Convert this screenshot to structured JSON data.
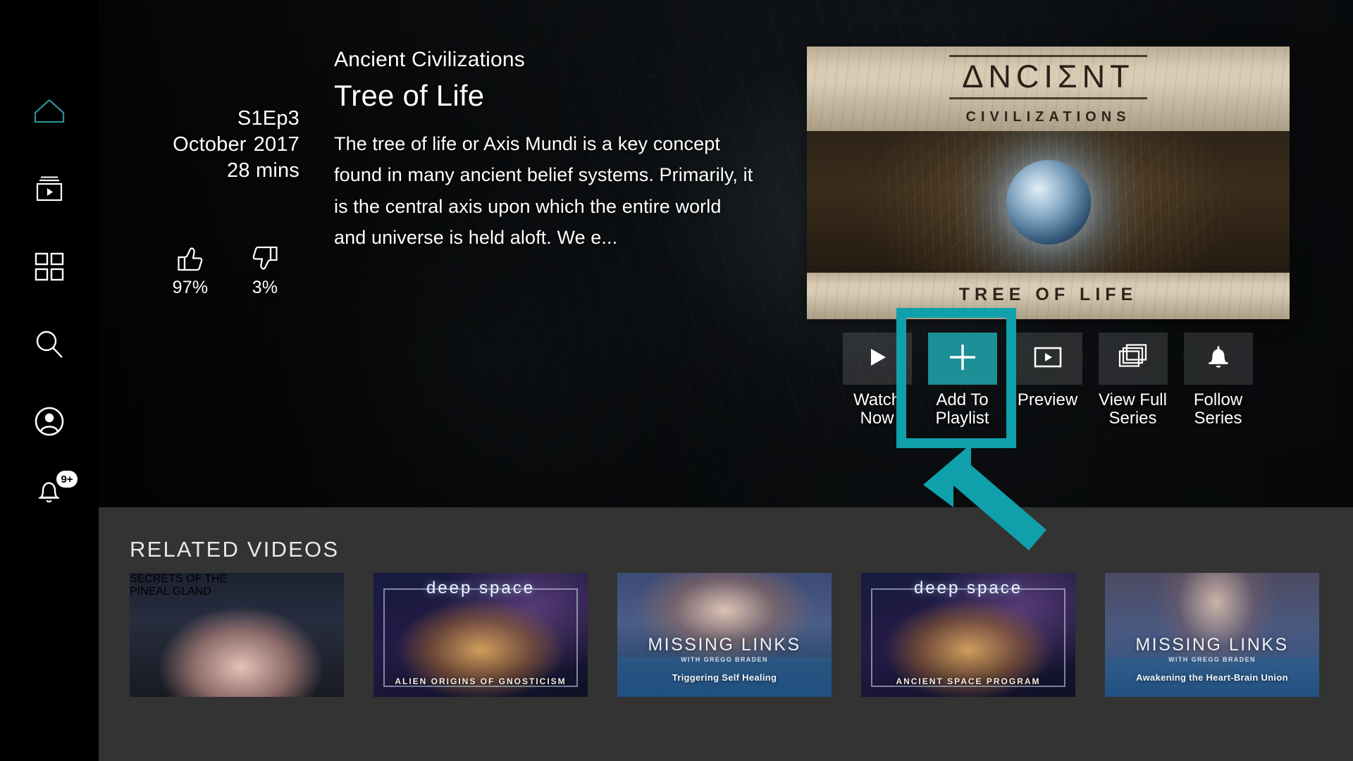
{
  "sidebar": {
    "items": [
      {
        "name": "home",
        "icon": "home-icon",
        "active": true
      },
      {
        "name": "library",
        "icon": "video-library-icon",
        "active": false
      },
      {
        "name": "browse",
        "icon": "grid-apps-icon",
        "active": false
      },
      {
        "name": "search",
        "icon": "search-icon",
        "active": false
      },
      {
        "name": "account",
        "icon": "account-circle-icon",
        "active": false
      },
      {
        "name": "notifications",
        "icon": "bell-icon",
        "active": false,
        "badge": "9+"
      }
    ]
  },
  "hero": {
    "series_name": "Ancient Civilizations",
    "episode_title": "Tree of Life",
    "episode_number": "S1Ep3",
    "release_month": "October",
    "release_year": "2017",
    "duration": "28 mins",
    "description": "The tree of life or Axis Mundi is a key concept found in many ancient belief systems. Primarily, it is the central axis upon which the entire world and universe is held aloft. We e...",
    "ratings": {
      "up_percent": "97%",
      "down_percent": "3%"
    },
    "poster": {
      "title_top": "ΔNCIΣNT",
      "title_sub": "CIVILIZATIONS",
      "title_bottom": "TREE OF LIFE"
    }
  },
  "actions": [
    {
      "id": "watch-now",
      "icon": "play-icon",
      "line1": "Watch",
      "line2": "Now",
      "highlighted": false
    },
    {
      "id": "add-to-playlist",
      "icon": "plus-icon",
      "line1": "Add To",
      "line2": "Playlist",
      "highlighted": true
    },
    {
      "id": "preview",
      "icon": "preview-video-icon",
      "line1": "Preview",
      "line2": "",
      "highlighted": false
    },
    {
      "id": "view-full-series",
      "icon": "stacked-cards-icon",
      "line1": "View Full",
      "line2": "Series",
      "highlighted": false
    },
    {
      "id": "follow-series",
      "icon": "bell-icon",
      "line1": "Follow",
      "line2": "Series",
      "highlighted": false
    }
  ],
  "related": {
    "title": "RELATED VIDEOS",
    "videos": [
      {
        "style": "pineal",
        "line1": "SECRETS OF THE",
        "line2": "PINEAL GLAND"
      },
      {
        "style": "deep-space",
        "brand": "deep space",
        "subtitle": "ALIEN ORIGINS OF GNOSTICISM"
      },
      {
        "style": "missing-links",
        "brand": "MISSING LINKS",
        "credit": "WITH GREGG BRADEN",
        "subtitle": "Triggering Self Healing"
      },
      {
        "style": "deep-space",
        "brand": "deep space",
        "subtitle": "ANCIENT SPACE PROGRAM"
      },
      {
        "style": "missing-links-alt",
        "brand": "MISSING LINKS",
        "credit": "WITH GREGG BRADEN",
        "subtitle": "Awakening the Heart-Brain Union"
      }
    ]
  },
  "colors": {
    "accent_teal": "#10a0ab",
    "highlight_tile": "#1d8f96",
    "related_bg": "#333333",
    "sidebar_bg": "#000000"
  }
}
